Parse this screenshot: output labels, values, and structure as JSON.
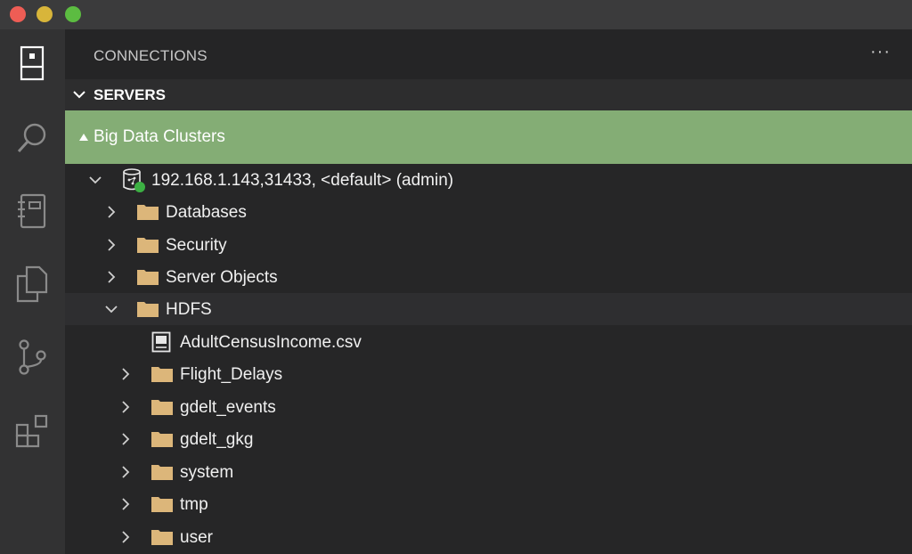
{
  "window": {
    "traffic_lights": [
      "close",
      "minimize",
      "zoom"
    ]
  },
  "activity_bar": {
    "icons": [
      "servers-icon",
      "search-icon",
      "notebook-icon",
      "explorer-icon",
      "source-control-icon",
      "extensions-icon"
    ]
  },
  "panel": {
    "title": "CONNECTIONS",
    "more_label": "···"
  },
  "section": {
    "title": "SERVERS",
    "expanded": true
  },
  "group": {
    "label": "Big Data Clusters",
    "color": "#84ad75"
  },
  "tree": {
    "server": {
      "label": "192.168.1.143,31433, <default> (admin)",
      "status_color": "#3cb043",
      "expanded": true
    },
    "folders": [
      {
        "label": "Databases",
        "expanded": false
      },
      {
        "label": "Security",
        "expanded": false
      },
      {
        "label": "Server Objects",
        "expanded": false
      },
      {
        "label": "HDFS",
        "expanded": true
      }
    ],
    "hdfs_children": [
      {
        "label": "AdultCensusIncome.csv",
        "type": "file"
      },
      {
        "label": "Flight_Delays",
        "type": "folder"
      },
      {
        "label": "gdelt_events",
        "type": "folder"
      },
      {
        "label": "gdelt_gkg",
        "type": "folder"
      },
      {
        "label": "system",
        "type": "folder"
      },
      {
        "label": "tmp",
        "type": "folder"
      },
      {
        "label": "user",
        "type": "folder"
      }
    ]
  },
  "colors": {
    "folder": "#dcb67a",
    "selected_group": "#84ad75"
  }
}
